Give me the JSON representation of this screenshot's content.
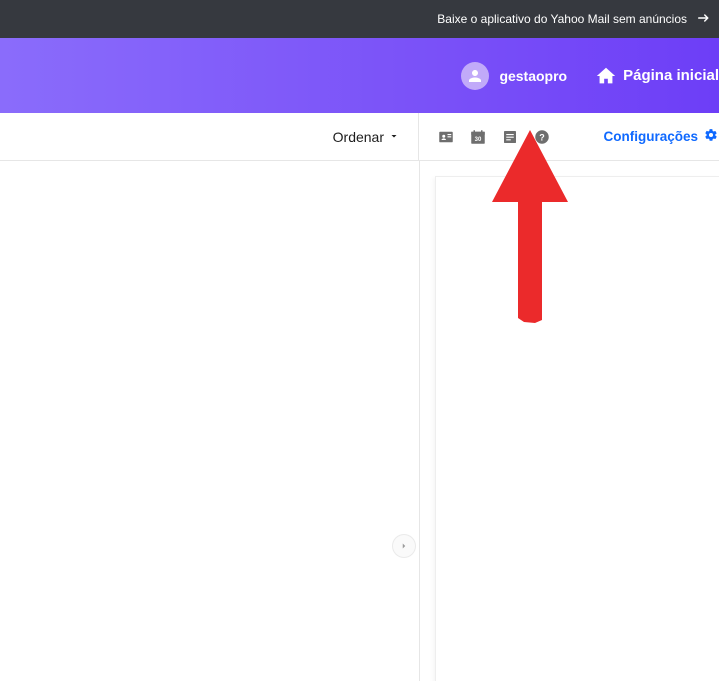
{
  "topbar": {
    "promo_text": "Baixe o aplicativo do Yahoo Mail sem anúncios"
  },
  "header": {
    "username": "gestaopro",
    "home_label": "Página inicial"
  },
  "toolbar": {
    "sort_label": "Ordenar",
    "config_label": "Configurações",
    "calendar_day": "30"
  }
}
